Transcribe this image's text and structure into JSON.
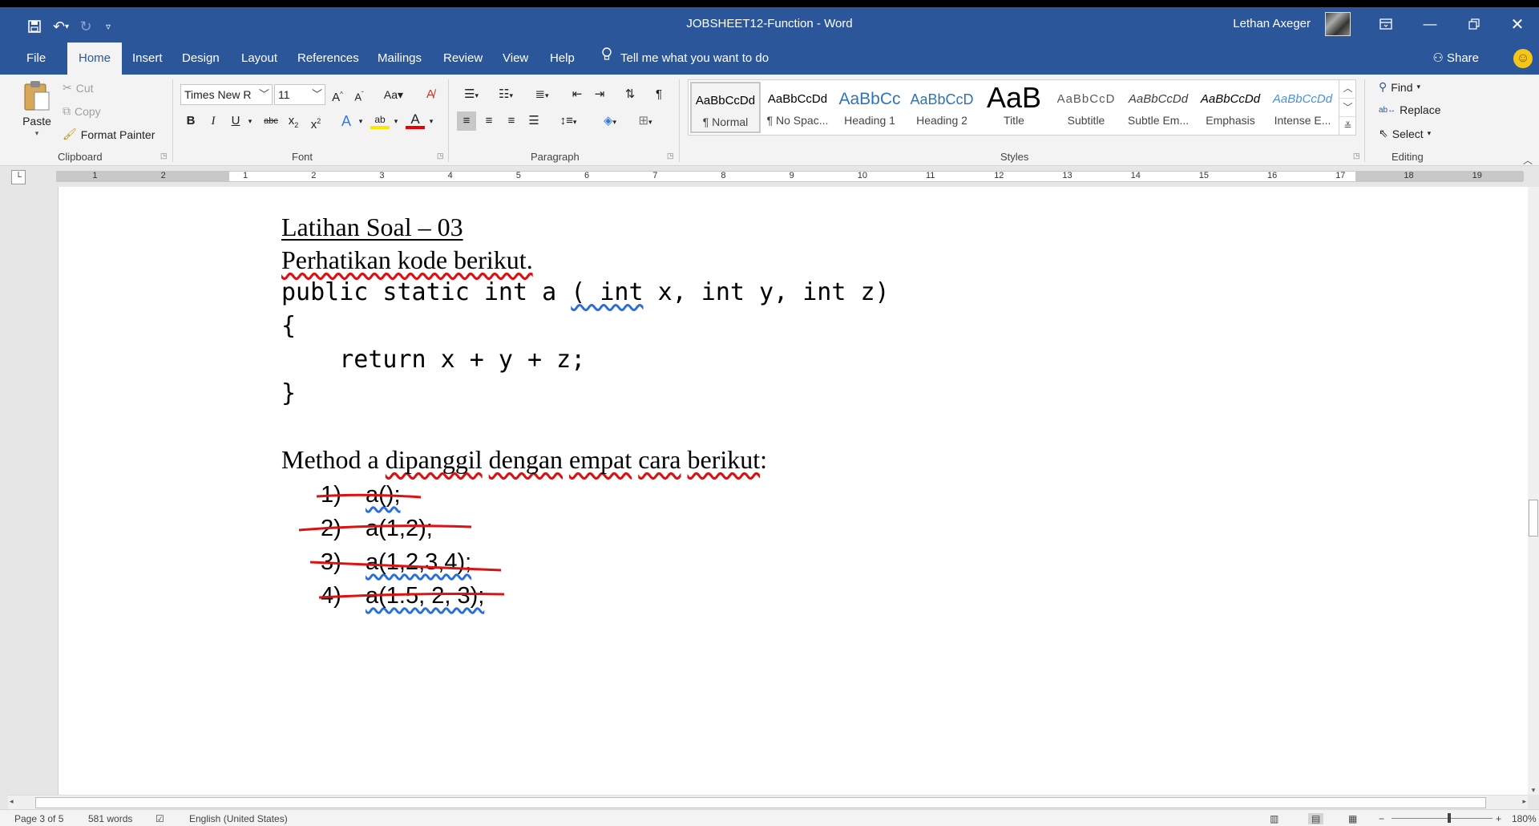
{
  "window": {
    "title": "JOBSHEET12-Function  -  Word",
    "user": "Lethan Axeger"
  },
  "tabs": [
    "File",
    "Home",
    "Insert",
    "Design",
    "Layout",
    "References",
    "Mailings",
    "Review",
    "View",
    "Help"
  ],
  "active_tab": "Home",
  "tell_me": "Tell me what you want to do",
  "share": "Share",
  "clipboard": {
    "paste": "Paste",
    "cut": "Cut",
    "copy": "Copy",
    "format_painter": "Format Painter",
    "label": "Clipboard"
  },
  "font": {
    "name": "Times New R",
    "size": "11",
    "label": "Font",
    "case_label": "Aa"
  },
  "paragraph": {
    "label": "Paragraph"
  },
  "styles": {
    "label": "Styles",
    "items": [
      {
        "sample": "AaBbCcDd",
        "name": "¶ Normal"
      },
      {
        "sample": "AaBbCcDd",
        "name": "¶ No Spac..."
      },
      {
        "sample": "AaBbCc",
        "name": "Heading 1"
      },
      {
        "sample": "AaBbCcD",
        "name": "Heading 2"
      },
      {
        "sample": "AaB",
        "name": "Title"
      },
      {
        "sample": "AaBbCcD",
        "name": "Subtitle"
      },
      {
        "sample": "AaBbCcDd",
        "name": "Subtle Em..."
      },
      {
        "sample": "AaBbCcDd",
        "name": "Emphasis"
      },
      {
        "sample": "AaBbCcDd",
        "name": "Intense E..."
      }
    ]
  },
  "editing": {
    "find": "Find",
    "replace": "Replace",
    "select": "Select",
    "label": "Editing"
  },
  "ruler": {
    "left_numbers": [
      "2",
      "1"
    ],
    "numbers": [
      "1",
      "2",
      "3",
      "4",
      "5",
      "6",
      "7",
      "8",
      "9",
      "10",
      "11",
      "12",
      "13",
      "14",
      "15",
      "16",
      "17",
      "18",
      "19"
    ]
  },
  "document": {
    "heading": "Latihan Soal – 03",
    "intro": "Perhatikan kode berikut.",
    "code_line1_a": "public static int a ",
    "code_line1_b": "( int",
    "code_line1_c": " x, int y, int z)",
    "code_line2": "{",
    "code_line3": "    return x + y + z;",
    "code_line4": "}",
    "method_intro_a": "Method a ",
    "method_intro_b": "dipanggil",
    "method_intro_c": " ",
    "method_intro_d": "dengan",
    "method_intro_e": " ",
    "method_intro_f": "empat",
    "method_intro_g": " ",
    "method_intro_h": "cara",
    "method_intro_i": " ",
    "method_intro_j": "berikut",
    "method_intro_k": ":",
    "list": [
      {
        "num": "1)",
        "code": "a();"
      },
      {
        "num": "2)",
        "code": "a(1,2);"
      },
      {
        "num": "3)",
        "code": "a(1,2,3,4);"
      },
      {
        "num": "4)",
        "code": "a(1.5, 2, 3);"
      }
    ]
  },
  "status": {
    "page": "Page 3 of 5",
    "words": "581 words",
    "language": "English (United States)",
    "zoom": "180%"
  },
  "colors": {
    "title_bar": "#2b579a",
    "ribbon": "#f3f3f3",
    "strike_annotation": "#e01010"
  }
}
